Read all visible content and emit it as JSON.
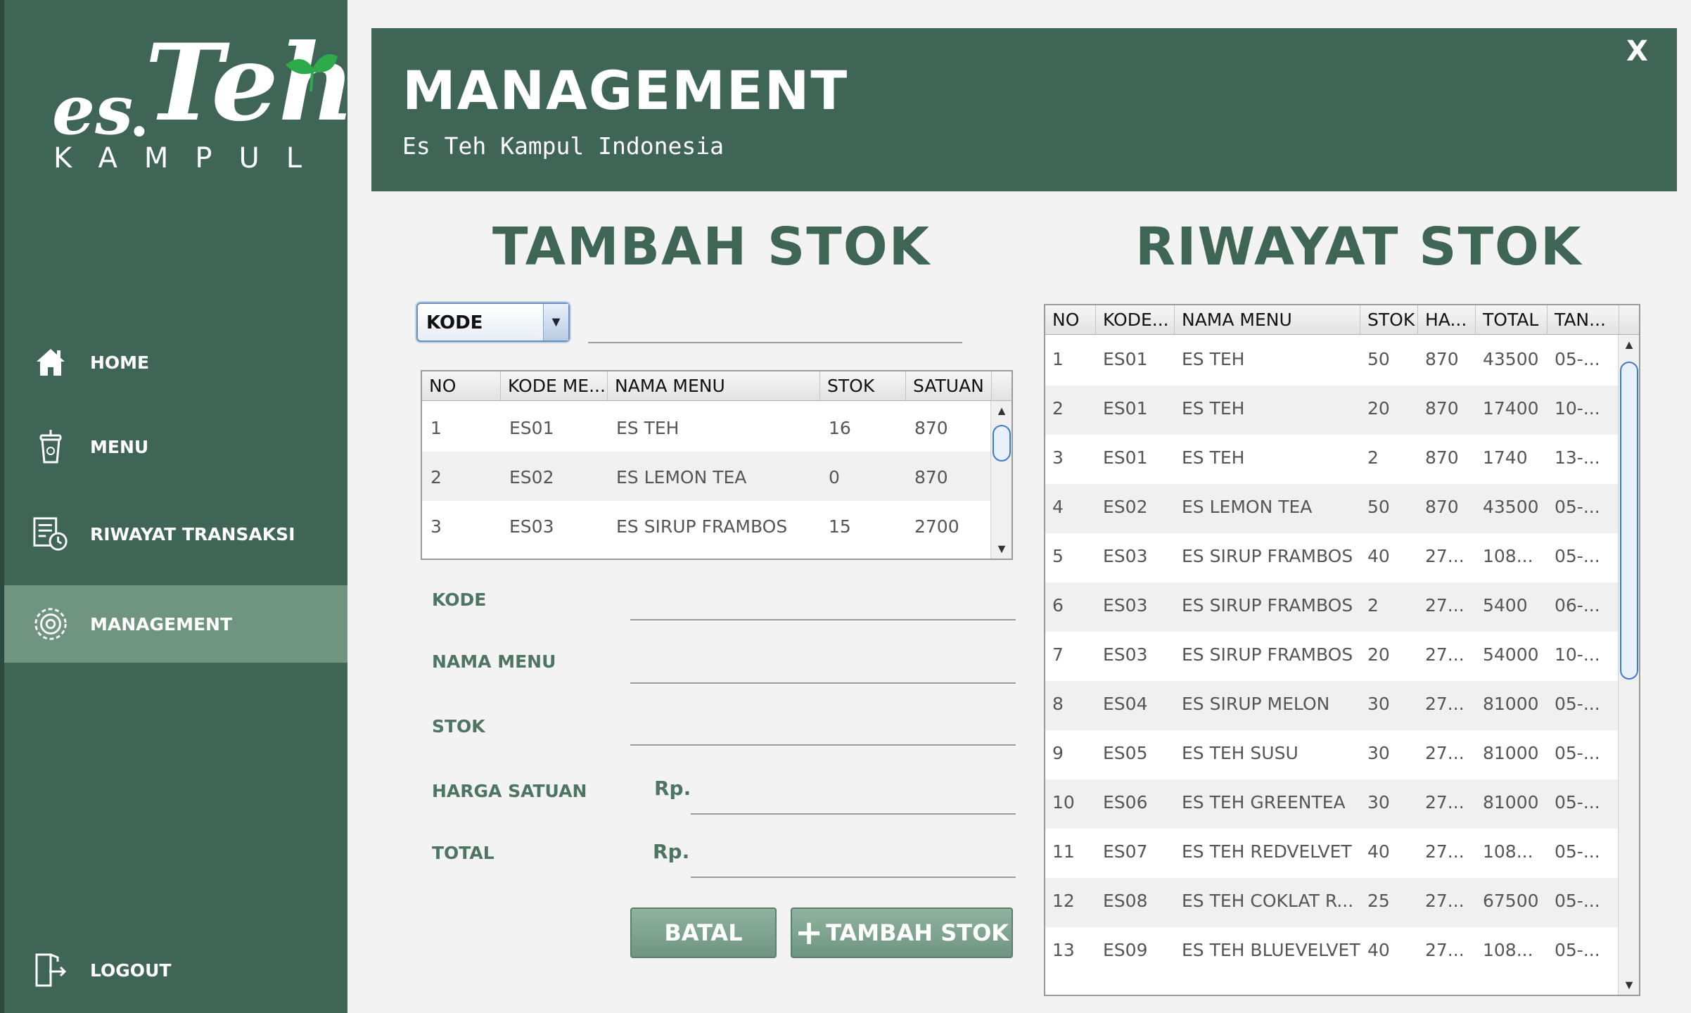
{
  "logo": {
    "es": "es",
    "dot": ".",
    "teh": "Teh",
    "kampul": "KAMPUL"
  },
  "nav": [
    {
      "label": "HOME",
      "icon": "home-icon"
    },
    {
      "label": "MENU",
      "icon": "drink-cup-icon"
    },
    {
      "label": "RIWAYAT TRANSAKSI",
      "icon": "transaction-history-icon"
    },
    {
      "label": "MANAGEMENT",
      "icon": "management-gear-icon",
      "active": true
    },
    {
      "label": "LOGOUT",
      "icon": "logout-icon"
    }
  ],
  "header": {
    "title": "MANAGEMENT",
    "subtitle": "Es Teh Kampul Indonesia",
    "close": "X"
  },
  "tambah": {
    "title": "TAMBAH STOK",
    "combo_value": "KODE",
    "table": {
      "headers": [
        "NO",
        "KODE ME...",
        "NAMA MENU",
        "STOK",
        "SATUAN"
      ],
      "rows": [
        [
          "1",
          "ES01",
          "ES TEH",
          "16",
          "870"
        ],
        [
          "2",
          "ES02",
          "ES LEMON TEA",
          "0",
          "870"
        ],
        [
          "3",
          "ES03",
          "ES SIRUP FRAMBOS",
          "15",
          "2700"
        ]
      ]
    },
    "form": {
      "kode_label": "KODE",
      "nama_label": "NAMA MENU",
      "stok_label": "STOK",
      "harga_label": "HARGA SATUAN",
      "total_label": "TOTAL",
      "currency": "Rp."
    },
    "batal_label": "BATAL",
    "tambah_label": "TAMBAH STOK",
    "plus": "+"
  },
  "riwayat": {
    "title": "RIWAYAT STOK",
    "table": {
      "headers": [
        "NO",
        "KODE...",
        "NAMA MENU",
        "STOK",
        "HA...",
        "TOTAL",
        "TAN..."
      ],
      "rows": [
        [
          "1",
          "ES01",
          "ES TEH",
          "50",
          "870",
          "43500",
          "05-..."
        ],
        [
          "2",
          "ES01",
          "ES TEH",
          "20",
          "870",
          "17400",
          "10-..."
        ],
        [
          "3",
          "ES01",
          "ES TEH",
          "2",
          "870",
          "1740",
          "13-..."
        ],
        [
          "4",
          "ES02",
          "ES LEMON TEA",
          "50",
          "870",
          "43500",
          "05-..."
        ],
        [
          "5",
          "ES03",
          "ES SIRUP FRAMBOS",
          "40",
          "27...",
          "108...",
          "05-..."
        ],
        [
          "6",
          "ES03",
          "ES SIRUP FRAMBOS",
          "2",
          "27...",
          "5400",
          "06-..."
        ],
        [
          "7",
          "ES03",
          "ES SIRUP FRAMBOS",
          "20",
          "27...",
          "54000",
          "10-..."
        ],
        [
          "8",
          "ES04",
          "ES SIRUP MELON",
          "30",
          "27...",
          "81000",
          "05-..."
        ],
        [
          "9",
          "ES05",
          "ES TEH SUSU",
          "30",
          "27...",
          "81000",
          "05-..."
        ],
        [
          "10",
          "ES06",
          "ES TEH GREENTEA",
          "30",
          "27...",
          "81000",
          "05-..."
        ],
        [
          "11",
          "ES07",
          "ES TEH REDVELVET",
          "40",
          "27...",
          "108...",
          "05-..."
        ],
        [
          "12",
          "ES08",
          "ES TEH COKLAT R...",
          "25",
          "27...",
          "67500",
          "05-..."
        ],
        [
          "13",
          "ES09",
          "ES TEH BLUEVELVET",
          "40",
          "27...",
          "108...",
          "05-..."
        ]
      ]
    }
  },
  "scroll": {
    "up": "▲",
    "down": "▼"
  },
  "colors": {
    "primary": "#3e6556",
    "active_nav": "#6f9581",
    "accent_text": "#4e7463",
    "leaf": "#2eaa4a"
  }
}
